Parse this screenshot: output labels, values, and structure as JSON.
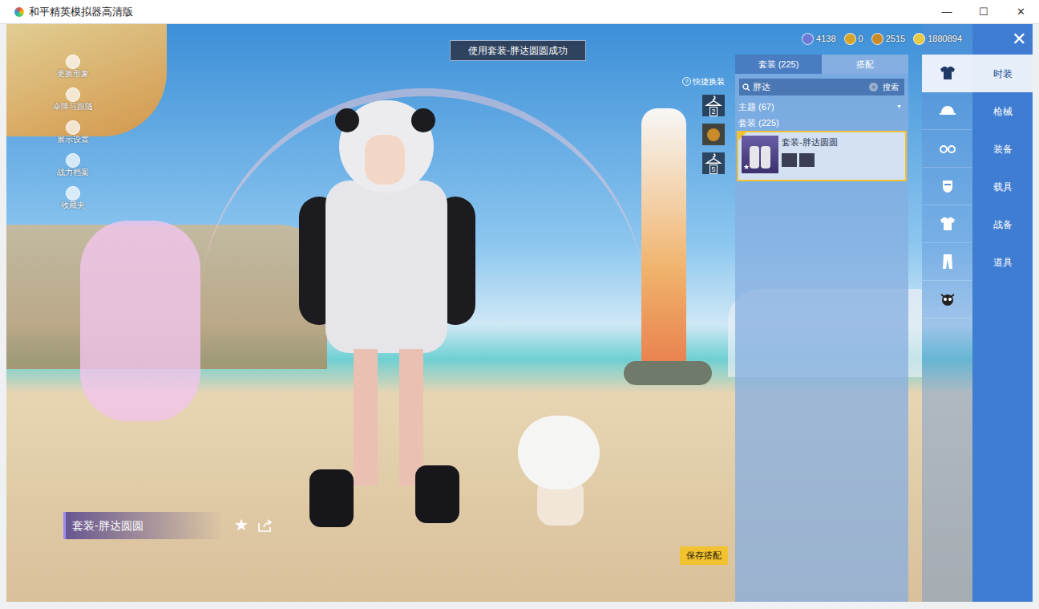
{
  "window": {
    "title": "和平精英模拟器高清版",
    "controls": [
      "—",
      "☐",
      "✕"
    ]
  },
  "side_menu": [
    {
      "label": "更换形象"
    },
    {
      "label": "伞降与跟随"
    },
    {
      "label": "展示设置"
    },
    {
      "label": "战力档案"
    },
    {
      "label": "收藏夹"
    }
  ],
  "toast": "使用套装-胖达圆圆成功",
  "currencies": [
    {
      "value": "4138",
      "color": "#6b7bd6"
    },
    {
      "value": "0",
      "color": "#d4a52a"
    },
    {
      "value": "2515",
      "color": "#c98a2a"
    },
    {
      "value": "1880894",
      "color": "#e6c845"
    }
  ],
  "close_button": "✕",
  "quick_change": {
    "label": "快捷换装",
    "help": "?",
    "slots": [
      {
        "kind": "hanger",
        "label": "2"
      },
      {
        "kind": "badge"
      },
      {
        "kind": "hanger",
        "label": "5"
      }
    ]
  },
  "panel": {
    "tabs": [
      {
        "label": "套装 (225)",
        "selected": true
      },
      {
        "label": "搭配",
        "selected": false
      }
    ],
    "search": {
      "value": "胖达",
      "clear": "✕",
      "button": "搜索"
    },
    "filter": {
      "label": "主题 (67)",
      "arrow": "▼",
      "expanded": false
    },
    "section": "套装 (225)",
    "results": [
      {
        "name": "套装-胖达圆圆",
        "selected": true,
        "favorite": true
      }
    ]
  },
  "icon_tabs": [
    {
      "kind": "outfit",
      "selected": true
    },
    {
      "kind": "hat",
      "selected": false
    },
    {
      "kind": "glasses",
      "selected": false
    },
    {
      "kind": "mask",
      "selected": false
    },
    {
      "kind": "top",
      "selected": false
    },
    {
      "kind": "pants",
      "selected": false
    },
    {
      "kind": "pet",
      "selected": false
    }
  ],
  "categories": [
    {
      "label": "时装",
      "selected": true
    },
    {
      "label": "枪械",
      "selected": false
    },
    {
      "label": "装备",
      "selected": false
    },
    {
      "label": "载具",
      "selected": false
    },
    {
      "label": "战备",
      "selected": false
    },
    {
      "label": "道具",
      "selected": false
    }
  ],
  "nameplate": {
    "name": "套装-胖达圆圆"
  },
  "save_button": "保存搭配"
}
